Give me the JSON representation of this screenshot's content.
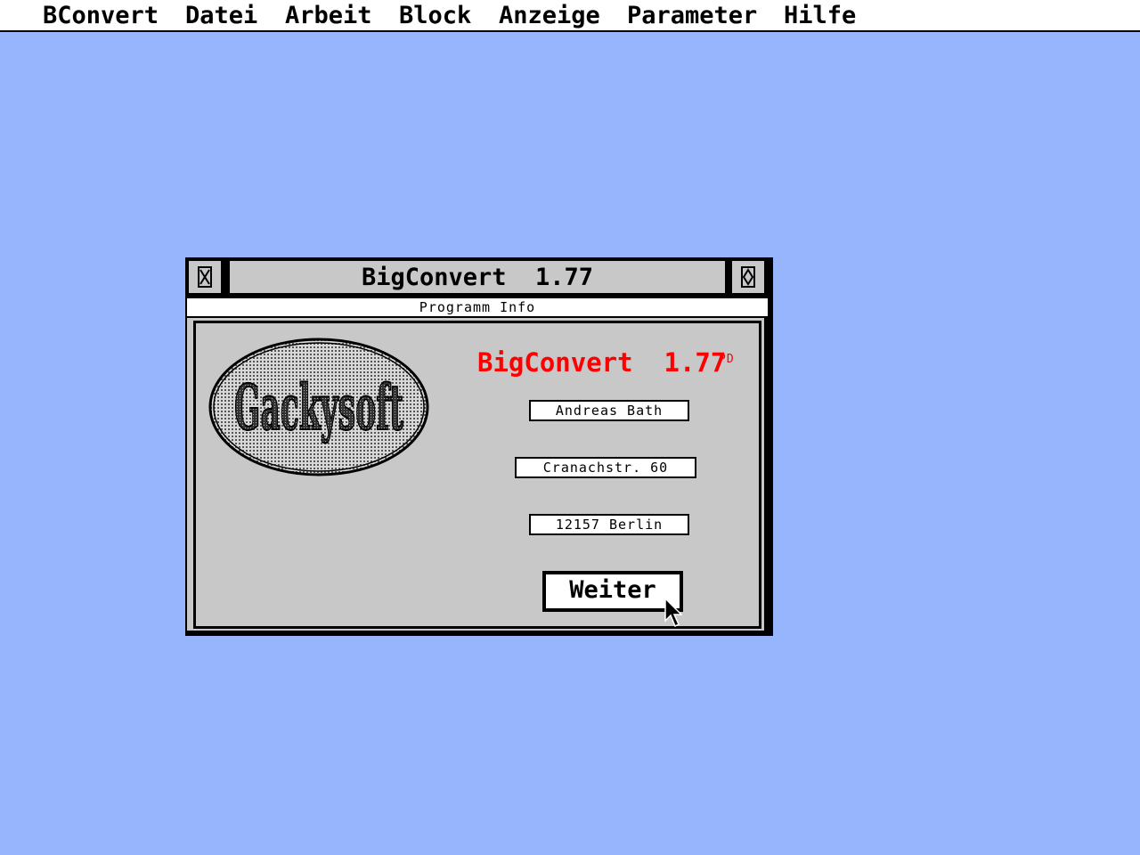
{
  "menubar": {
    "items": [
      {
        "label": "BConvert"
      },
      {
        "label": "Datei"
      },
      {
        "label": "Arbeit"
      },
      {
        "label": "Block"
      },
      {
        "label": "Anzeige"
      },
      {
        "label": "Parameter"
      },
      {
        "label": "Hilfe"
      }
    ]
  },
  "window": {
    "title": "BigConvert  1.77",
    "info_line": "Programm Info",
    "closer_icon": "close-icon",
    "fuller_icon": "fuller-icon"
  },
  "dialog": {
    "logo_text": "Gackysoft",
    "app_title": "BigConvert  1.77",
    "badge": "PD",
    "author_name": "Andreas Bath",
    "street": "Cranachstr. 60",
    "city": "12157 Berlin",
    "ok_button": "Weiter"
  },
  "colors": {
    "desktop": "#97b5fc",
    "window_gray": "#c8c8c8",
    "title_accent": "#ff0000"
  }
}
